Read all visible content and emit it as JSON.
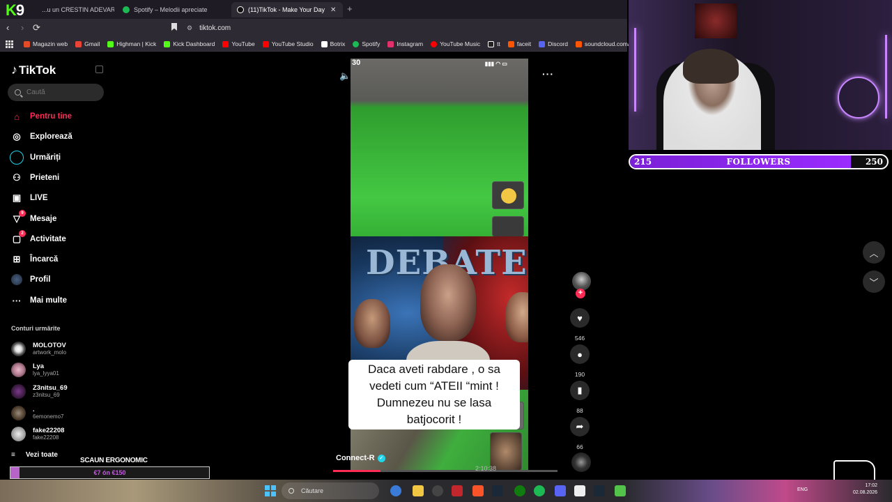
{
  "browser": {
    "kick_logo": "K",
    "kick_count": "9",
    "tabs": [
      {
        "label": "...u un CRESTIN ADEVARAT ca",
        "active": false
      },
      {
        "label": "Spotify – Melodii apreciate",
        "active": false
      },
      {
        "label": "(11)TikTok - Make Your Day",
        "active": true
      }
    ],
    "new_tab": "+",
    "url": "tiktok.com",
    "bookmarks": [
      {
        "label": "Magazin web",
        "color": "#e34c26"
      },
      {
        "label": "Gmail",
        "color": "#ea4335"
      },
      {
        "label": "Highman | Kick",
        "color": "#53fc18"
      },
      {
        "label": "Kick Dashboard",
        "color": "#53fc18"
      },
      {
        "label": "YouTube",
        "color": "#ff0000"
      },
      {
        "label": "YouTube Studio",
        "color": "#ff0000"
      },
      {
        "label": "Botrix",
        "color": "#ffffff"
      },
      {
        "label": "Spotify",
        "color": "#1db954"
      },
      {
        "label": "Instagram",
        "color": "#e1306c"
      },
      {
        "label": "YouTube Music",
        "color": "#ff0000"
      },
      {
        "label": "tt",
        "color": "#ffffff"
      },
      {
        "label": "faceit",
        "color": "#ff5500"
      },
      {
        "label": "Discord",
        "color": "#5865f2"
      },
      {
        "label": "soundcloud.com/",
        "color": "#ff5500"
      }
    ]
  },
  "sidebar": {
    "logo": "TikTok",
    "search_placeholder": "Caută",
    "nav": [
      {
        "label": "Pentru tine",
        "icon": "home-icon",
        "active": true
      },
      {
        "label": "Explorează",
        "icon": "compass-icon"
      },
      {
        "label": "Urmăriți",
        "icon": "following-icon"
      },
      {
        "label": "Prieteni",
        "icon": "friends-icon"
      },
      {
        "label": "LIVE",
        "icon": "live-icon"
      },
      {
        "label": "Mesaje",
        "icon": "messages-icon",
        "badge": "9"
      },
      {
        "label": "Activitate",
        "icon": "activity-icon",
        "badge": "2"
      },
      {
        "label": "Încarcă",
        "icon": "upload-icon"
      },
      {
        "label": "Profil",
        "icon": "profile-icon"
      },
      {
        "label": "Mai multe",
        "icon": "more-icon"
      }
    ],
    "following_title": "Conturi urmărite",
    "following": [
      {
        "name": "MOLOTOV",
        "handle": "artwork_molo"
      },
      {
        "name": "Lya",
        "handle": "lya_lyya01"
      },
      {
        "name": "Z3nitsu_69",
        "handle": "z3nitsu_69"
      },
      {
        "name": ".",
        "handle": "6emonemo7"
      },
      {
        "name": "fake22208",
        "handle": "fake22208"
      }
    ],
    "see_all": "Vezi toate"
  },
  "goal_overlay": {
    "title": "SCAUN ERGONOMIC",
    "progress_text": "€7 ón €150",
    "fraction": 0.047
  },
  "video": {
    "status_time": "30",
    "thumbnail_title": "DEBATE",
    "caption": "Daca aveti rabdare , o sa vedeti cum “ATEII “mint ! Dumnezeu nu se lasa batjocorit !",
    "author": "Connect-R",
    "timecode": "2:10:38",
    "progress_fraction": 0.21
  },
  "actions": {
    "likes": "546",
    "comments": "190",
    "saves": "88",
    "shares": "66"
  },
  "followers_goal": {
    "current": "215",
    "label": "FOLLOWERS",
    "goal": "250",
    "fraction": 0.86
  },
  "taskbar": {
    "search_placeholder": "Căutare",
    "lang": "ENG",
    "time": "17:02",
    "date": "02.08.2026"
  }
}
